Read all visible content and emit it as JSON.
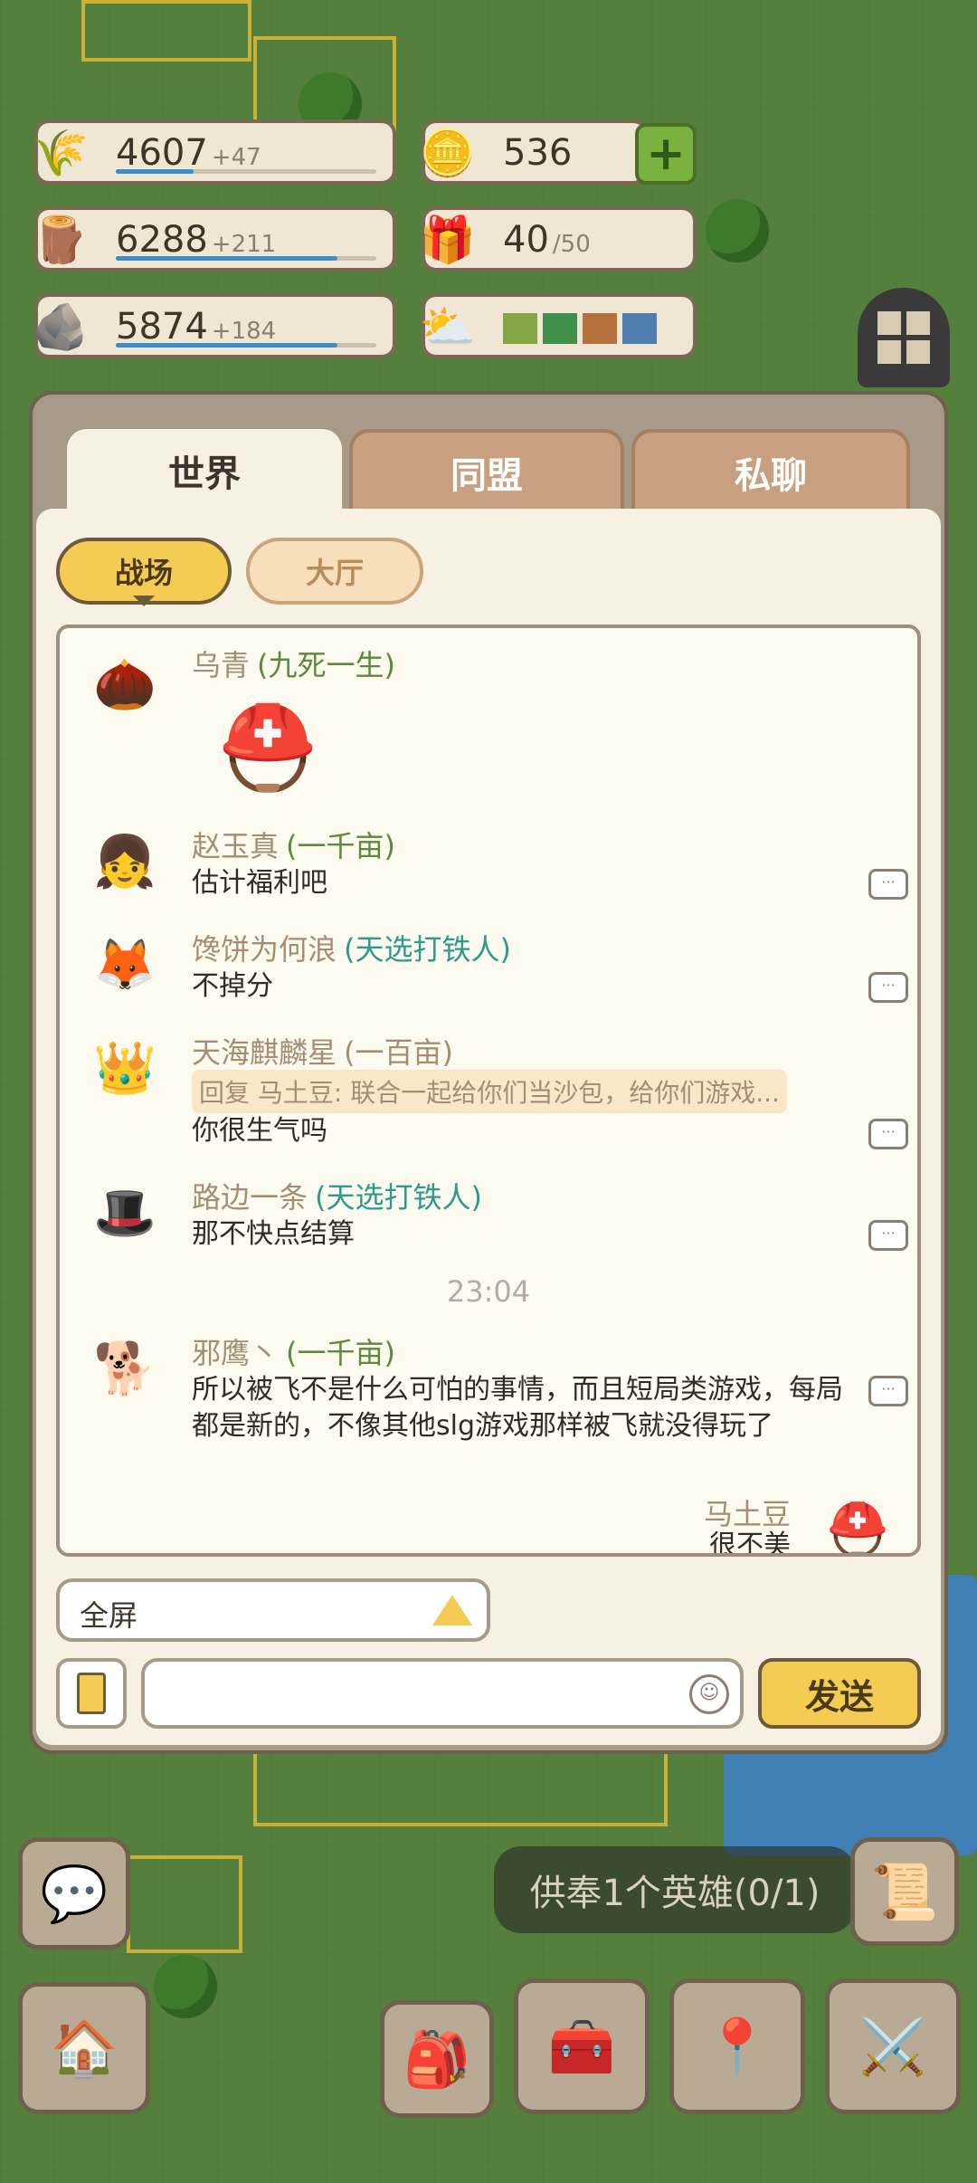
{
  "resources": [
    {
      "icon": "wheat-icon",
      "value": "4607",
      "delta": "+47",
      "fill": 0.3
    },
    {
      "icon": "wood-log-icon",
      "value": "6288",
      "delta": "+211",
      "fill": 0.85
    },
    {
      "icon": "stone-icon",
      "value": "5874",
      "delta": "+184",
      "fill": 0.85
    }
  ],
  "coins": {
    "icon": "coin-icon",
    "value": "536"
  },
  "gifts": {
    "icon": "gift-icon",
    "value": "40",
    "max": "/50"
  },
  "weather": {
    "icon": "weather-icon",
    "colors": [
      "#86a645",
      "#3f8f4a",
      "#b5713e",
      "#4f7fae"
    ]
  },
  "chat": {
    "tabs": [
      "世界",
      "同盟",
      "私聊"
    ],
    "subtabs": [
      "战场",
      "大厅"
    ],
    "messages": [
      {
        "name": "乌青",
        "title": "(九死一生)",
        "title_color": "#5a8a3a",
        "avatar": "acorn-avatar",
        "text": "",
        "sticker": "helmet-sticker"
      },
      {
        "name": "赵玉真",
        "title": "(一千亩)",
        "title_color": "#5a8a3a",
        "avatar": "girl-avatar",
        "text": "估计福利吧"
      },
      {
        "name": "馋饼为何浪",
        "title": "(天选打铁人)",
        "title_color": "#2e9a8a",
        "avatar": "fox-avatar",
        "text": "不掉分"
      },
      {
        "name": "天海麒麟星",
        "title": "(一百亩)",
        "title_color": "#a58d72",
        "avatar": "crown-avatar",
        "reply": "回复 马土豆: 联合一起给你们当沙包，给你们游戏...",
        "text": "你很生气吗"
      },
      {
        "name": "路边一条",
        "title": "(天选打铁人)",
        "title_color": "#2e9a8a",
        "avatar": "red-hat-avatar",
        "text": "那不快点结算"
      },
      {
        "name": "邪鹰丶",
        "title": "(一千亩)",
        "title_color": "#5a8a3a",
        "avatar": "dog-avatar",
        "text": "所以被飞不是什么可怕的事情，而且短局类游戏，每局都是新的，不像其他slg游戏那样被飞就没得玩了"
      },
      {
        "name": "马土豆",
        "title": "",
        "avatar": "helmet-avatar",
        "text": "很不美"
      }
    ],
    "time": "23:04",
    "fullscreen_label": "全屏",
    "input_placeholder": "",
    "send_label": "发送"
  },
  "quest_text": "供奉1个英雄(0/1)"
}
